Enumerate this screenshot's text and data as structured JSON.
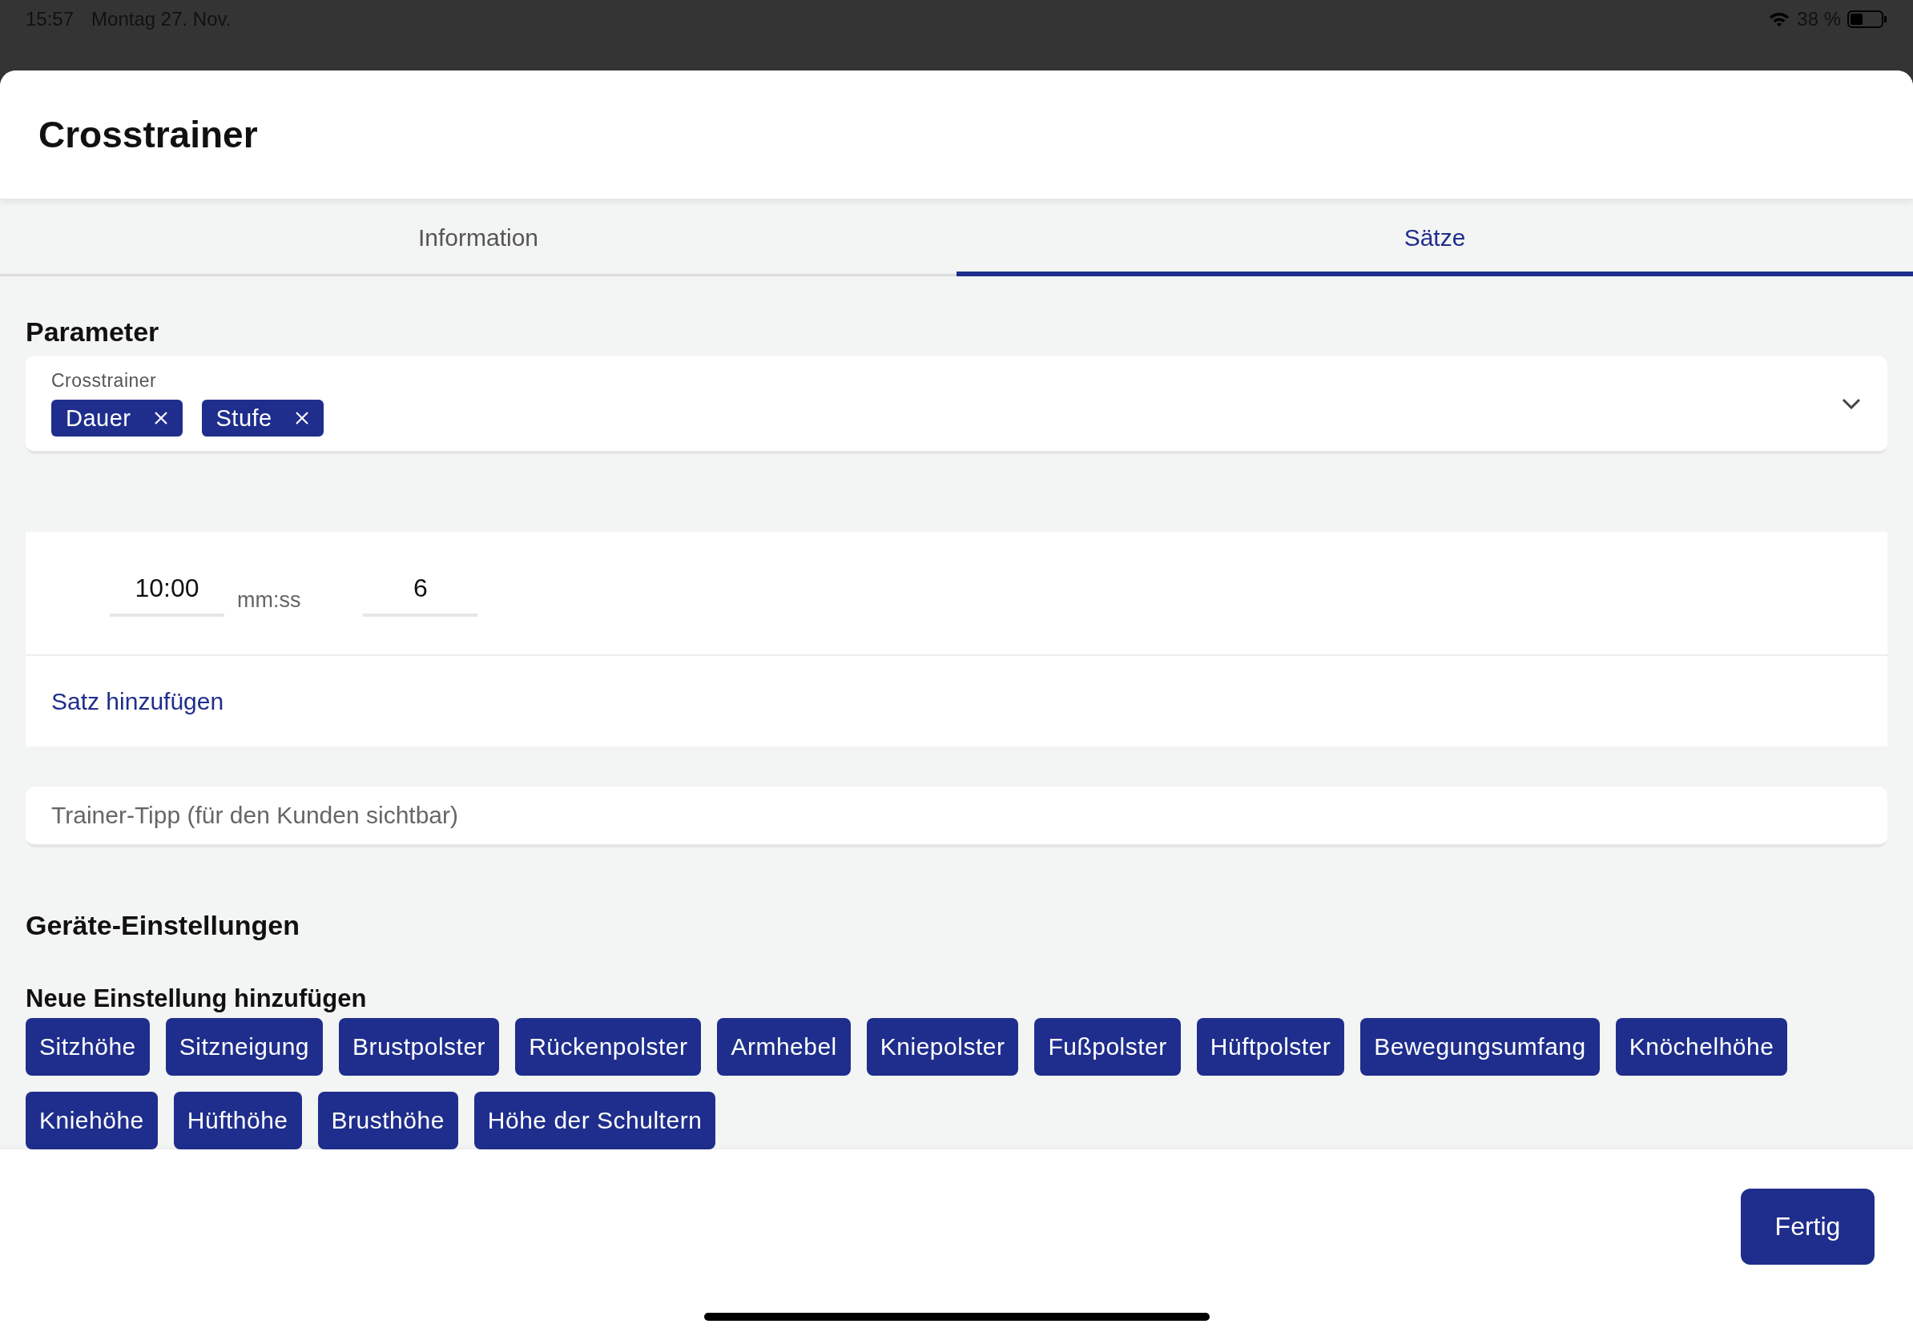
{
  "status_bar": {
    "time": "15:57",
    "date": "Montag 27. Nov.",
    "battery": "38 %"
  },
  "sheet": {
    "title": "Crosstrainer"
  },
  "tabs": [
    {
      "label": "Information",
      "selected": false
    },
    {
      "label": "Sätze",
      "selected": true
    }
  ],
  "parameter": {
    "heading": "Parameter",
    "label": "Crosstrainer",
    "chips": [
      "Dauer",
      "Stufe"
    ]
  },
  "sets": [
    {
      "duration": "10:00",
      "unit": "mm:ss",
      "level": "6"
    }
  ],
  "add_set": "Satz hinzufügen",
  "tip": {
    "placeholder": "Trainer-Tipp (für den Kunden sichtbar)"
  },
  "settings": {
    "heading": "Geräte-Einstellungen",
    "subheading": "Neue Einstellung hinzufügen",
    "options": [
      "Sitzhöhe",
      "Sitzneigung",
      "Brustpolster",
      "Rückenpolster",
      "Armhebel",
      "Kniepolster",
      "Fußpolster",
      "Hüftpolster",
      "Bewegungsumfang",
      "Knöchelhöhe",
      "Kniehöhe",
      "Hüfthöhe",
      "Brusthöhe",
      "Höhe der Schultern"
    ]
  },
  "footer": {
    "done": "Fertig"
  }
}
